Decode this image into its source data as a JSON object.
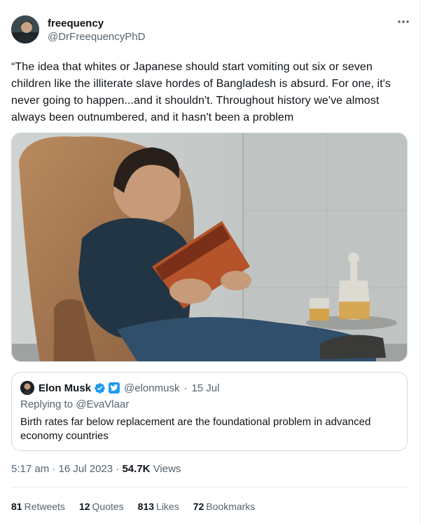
{
  "author": {
    "display_name": "freequency",
    "handle": "@DrFreequencyPhD"
  },
  "more_icon": "more-horizontal-icon",
  "tweet": {
    "text": "“The idea that whites or Japanese should start vomiting out six or seven children like the illiterate slave hordes of Bangladesh is absurd. For one, it's never going to happen...and it shouldn't. Throughout history we've almost always been outnumbered, and it hasn't been a problem"
  },
  "quoted": {
    "display_name": "Elon Musk",
    "handle": "@elonmusk",
    "separator": "·",
    "date": "15 Jul",
    "reply_prefix": "Replying to",
    "reply_to": "@EvaVlaar",
    "text": "Birth rates far below replacement are the foundational problem in advanced economy countries",
    "verified_color": "#1d9bf0"
  },
  "meta": {
    "time": "5:17 am",
    "sep1": "·",
    "date": "16 Jul 2023",
    "sep2": "·",
    "views_count": "54.7K",
    "views_label": "Views"
  },
  "stats": [
    {
      "count": "81",
      "label": "Retweets"
    },
    {
      "count": "12",
      "label": "Quotes"
    },
    {
      "count": "813",
      "label": "Likes"
    },
    {
      "count": "72",
      "label": "Bookmarks"
    }
  ],
  "colors": {
    "text": "#0f1419",
    "secondary": "#536471",
    "border": "#cfd9de",
    "accent": "#1d9bf0"
  }
}
